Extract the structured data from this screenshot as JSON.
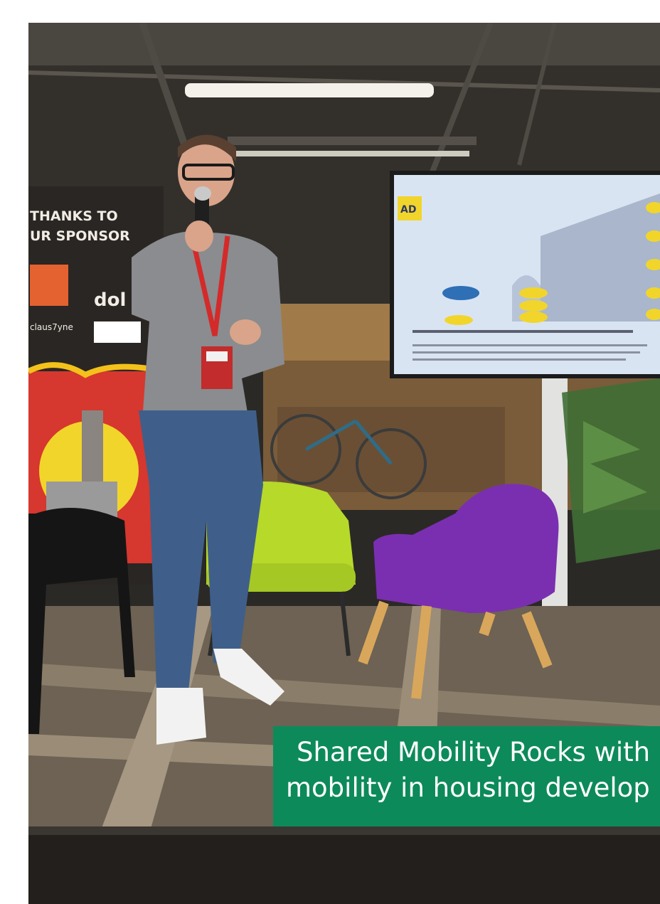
{
  "photo": {
    "description_icon": "photo-scene",
    "banner_lines": [
      "THANKS TO",
      "UR SPONSOR"
    ],
    "banner_logo_text": "dol",
    "sponsor_small": "claus7yne",
    "slide_logo": "AD"
  },
  "caption": {
    "line1": "Shared Mobility Rocks with",
    "line2": "mobility in housing develop"
  },
  "colors": {
    "caption_bg": "#0d8a5a",
    "caption_text": "#ffffff"
  }
}
